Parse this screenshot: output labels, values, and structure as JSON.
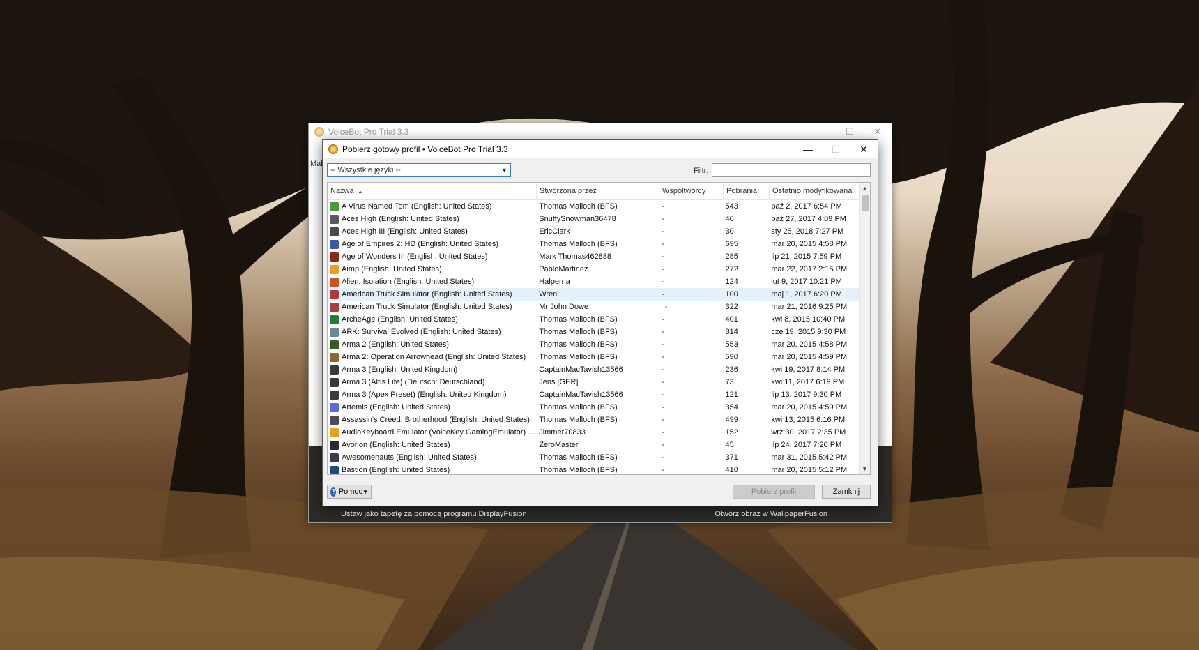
{
  "main_window": {
    "title": "VoiceBot Pro Trial 3.3",
    "side_label": "Mak",
    "min_glyph": "—",
    "max_glyph": "☐",
    "close_glyph": "✕"
  },
  "displayfusion": {
    "left_text": "Ustaw jako tapetę za pomocą programu DisplayFusion",
    "right_text": "Otwórz obraz w WallpaperFusion"
  },
  "dialog": {
    "title": "Pobierz gotowy profil • VoiceBot Pro Trial 3.3",
    "min_glyph": "—",
    "max_glyph": "☐",
    "close_glyph": "✕",
    "language_select": "-- Wszystkie języki --",
    "filter_label": "Filtr:",
    "filter_value": "",
    "columns": {
      "name": "Nazwa",
      "author": "Stworzona przez",
      "contributors": "Współtwórcy",
      "downloads": "Pobrania",
      "modified": "Ostatnio modyfikowana"
    },
    "sort_indicator": "▴",
    "help_button": "Pomoc",
    "download_button": "Pobierz profil",
    "close_button": "Zamknij",
    "rows": [
      {
        "name": "A Virus Named Tom (English: United States)",
        "author": "Thomas Malloch (BFS)",
        "co": "-",
        "dl": "543",
        "date": "paź 2, 2017 6:54 PM",
        "icon": "#4a9a3a"
      },
      {
        "name": "Aces High (English: United States)",
        "author": "SnuffySnowman36478",
        "co": "-",
        "dl": "40",
        "date": "paź 27, 2017 4:09 PM",
        "icon": "#5a5a5a"
      },
      {
        "name": "Aces High III (English: United States)",
        "author": "EricClark",
        "co": "-",
        "dl": "30",
        "date": "sty 25, 2018 7:27 PM",
        "icon": "#4a4a4a"
      },
      {
        "name": "Age of Empires 2: HD (English: United States)",
        "author": "Thomas Malloch (BFS)",
        "co": "-",
        "dl": "695",
        "date": "mar 20, 2015 4:58 PM",
        "icon": "#3a5aa8"
      },
      {
        "name": "Age of Wonders III (English: United States)",
        "author": "Mark Thomas462888",
        "co": "-",
        "dl": "285",
        "date": "lip 21, 2015 7:59 PM",
        "icon": "#8a2a1a"
      },
      {
        "name": "Aimp (English: United States)",
        "author": "PabloMartinez",
        "co": "-",
        "dl": "272",
        "date": "mar 22, 2017 2:15 PM",
        "icon": "#e8a020"
      },
      {
        "name": "Alien: Isolation (English: United States)",
        "author": "Halperna",
        "co": "-",
        "dl": "124",
        "date": "lut 9, 2017 10:21 PM",
        "icon": "#d05020"
      },
      {
        "name": "American Truck Simulator (English: United States)",
        "author": "Wren",
        "co": "-",
        "dl": "100",
        "date": "maj 1, 2017 6:20 PM",
        "icon": "#b03a3a",
        "selected": true
      },
      {
        "name": "American Truck Simulator (English: United States)",
        "author": "Mr John Dowe",
        "co": "-",
        "dl": "322",
        "date": "mar 21, 2016 9:25 PM",
        "icon": "#b03a3a",
        "boxed": true
      },
      {
        "name": "ArcheAge (English: United States)",
        "author": "Thomas Malloch (BFS)",
        "co": "-",
        "dl": "401",
        "date": "kwi 8, 2015 10:40 PM",
        "icon": "#2a7a3a"
      },
      {
        "name": "ARK: Survival Evolved (English: United States)",
        "author": "Thomas Malloch (BFS)",
        "co": "-",
        "dl": "814",
        "date": "cze 19, 2015 9:30 PM",
        "icon": "#6a8a9a"
      },
      {
        "name": "Arma 2 (English: United States)",
        "author": "Thomas Malloch (BFS)",
        "co": "-",
        "dl": "553",
        "date": "mar 20, 2015 4:58 PM",
        "icon": "#3a5a2a"
      },
      {
        "name": "Arma 2: Operation Arrowhead (English: United States)",
        "author": "Thomas Malloch (BFS)",
        "co": "-",
        "dl": "590",
        "date": "mar 20, 2015 4:59 PM",
        "icon": "#8a6a2a"
      },
      {
        "name": "Arma 3 (English: United Kingdom)",
        "author": "CaptainMacTavish13566",
        "co": "-",
        "dl": "236",
        "date": "kwi 19, 2017 8:14 PM",
        "icon": "#3a3a3a"
      },
      {
        "name": "Arma 3 (Altis Life) (Deutsch: Deutschland)",
        "author": "Jens [GER]",
        "co": "-",
        "dl": "73",
        "date": "kwi 11, 2017 6:19 PM",
        "icon": "#3a3a3a"
      },
      {
        "name": "Arma 3 (Apex Preset) (English: United Kingdom)",
        "author": "CaptainMacTavish13566",
        "co": "-",
        "dl": "121",
        "date": "lip 13, 2017 9:30 PM",
        "icon": "#3a3a3a"
      },
      {
        "name": "Artemis (English: United States)",
        "author": "Thomas Malloch (BFS)",
        "co": "-",
        "dl": "354",
        "date": "mar 20, 2015 4:59 PM",
        "icon": "#5a6ad8"
      },
      {
        "name": "Assassin's Creed: Brotherhood (English: United States)",
        "author": "Thomas Malloch (BFS)",
        "co": "-",
        "dl": "499",
        "date": "kwi 13, 2015 6:16 PM",
        "icon": "#4a4a5a"
      },
      {
        "name": "AudioKeyboard Emulator (VoiceKey GamingEmulator) (English:...",
        "author": "Jimmer70833",
        "co": "-",
        "dl": "152",
        "date": "wrz 30, 2017 2:35 PM",
        "icon": "#e8a020"
      },
      {
        "name": "Avorion (English: United States)",
        "author": "ZeroMaster",
        "co": "-",
        "dl": "45",
        "date": "lip 24, 2017 7:20 PM",
        "icon": "#2a2a2a"
      },
      {
        "name": "Awesomenauts (English: United States)",
        "author": "Thomas Malloch (BFS)",
        "co": "-",
        "dl": "371",
        "date": "mar 31, 2015 5:42 PM",
        "icon": "#3a3a4a"
      },
      {
        "name": "Bastion (English: United States)",
        "author": "Thomas Malloch (BFS)",
        "co": "-",
        "dl": "410",
        "date": "mar 20, 2015 5:12 PM",
        "icon": "#1a4a8a"
      }
    ]
  }
}
